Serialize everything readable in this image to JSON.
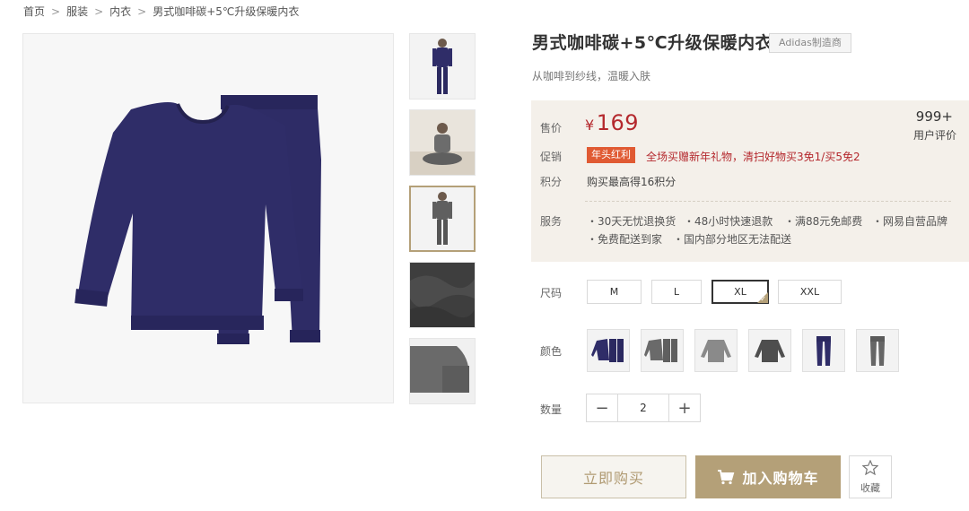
{
  "breadcrumb": {
    "items": [
      "首页",
      "服装",
      "内衣",
      "男式咖啡碳+5℃升级保暖内衣"
    ],
    "separator": ">"
  },
  "product": {
    "title": "男式咖啡碳+5℃升级保暖内衣",
    "maker_badge": "Adidas制造商",
    "subtitle": "从咖啡到纱线，温暖入肤"
  },
  "gallery": {
    "main_image": "navy-thermal-underwear-set",
    "thumbnails": [
      "model-front-navy",
      "model-sitting-grey",
      "model-standing-grey",
      "fabric-closeup",
      "cuff-detail"
    ],
    "active_thumbnail": 2
  },
  "price_box": {
    "price_label": "售价",
    "currency": "¥",
    "price": "169",
    "review_count": "999+",
    "review_label": "用户评价",
    "promo_label": "促销",
    "promo_tag": "年头红利",
    "promo_text": "全场买赠新年礼物，清扫好物买3免1/买5免2",
    "points_label": "积分",
    "points_text": "购买最高得16积分",
    "service_label": "服务",
    "services": [
      "・30天无忧退换货",
      "・48小时快速退款",
      "・满88元免邮费",
      "・网易自营品牌",
      "・免费配送到家",
      "・国内部分地区无法配送"
    ]
  },
  "options": {
    "size_label": "尺码",
    "sizes": [
      "M",
      "L",
      "XL",
      "XXL"
    ],
    "selected_size": "XL",
    "color_label": "颜色",
    "colors": [
      "navy-set",
      "grey-set",
      "light-grey-top",
      "dark-grey-top",
      "navy-pants",
      "grey-pants"
    ],
    "qty_label": "数量",
    "qty_minus": "−",
    "qty_value": "2",
    "qty_plus": "+"
  },
  "actions": {
    "buy_now": "立即购买",
    "add_cart": "加入购物车",
    "favorite": "收藏"
  },
  "colors": {
    "accent_gold": "#b4a078",
    "price_red": "#b4282d",
    "promo_orange": "#e05a33",
    "price_box_bg": "#f4f0ea"
  }
}
